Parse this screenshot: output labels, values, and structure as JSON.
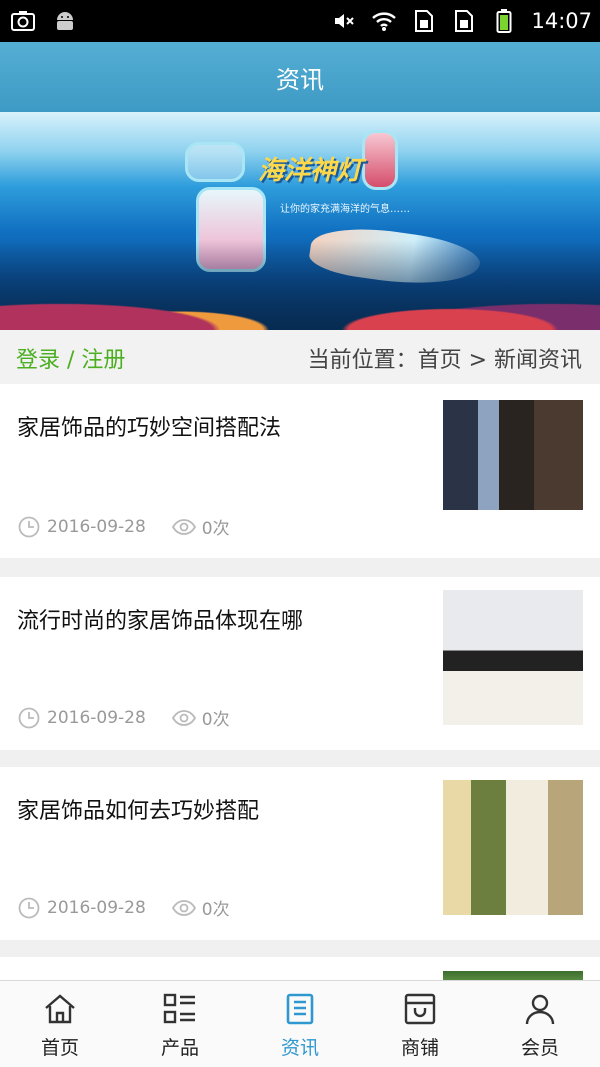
{
  "status_bar": {
    "time": "14:07",
    "left_icons": [
      "screenshot-icon",
      "android-icon"
    ],
    "right_icons": [
      "mute-icon",
      "wifi-icon",
      "sim1-icon",
      "sim2-icon",
      "battery-icon"
    ]
  },
  "header": {
    "title": "资讯"
  },
  "banner": {
    "title": "海洋神灯",
    "subtitle": "让你的家充满海洋的气息……"
  },
  "crumb": {
    "login_label": "登录 / 注册",
    "location": "当前位置：首页 > 新闻资讯"
  },
  "news": [
    {
      "title": "家居饰品的巧妙空间搭配法",
      "date": "2016-09-28",
      "views": "0次"
    },
    {
      "title": "流行时尚的家居饰品体现在哪",
      "date": "2016-09-28",
      "views": "0次"
    },
    {
      "title": "家居饰品如何去巧妙搭配",
      "date": "2016-09-28",
      "views": "0次"
    }
  ],
  "tabs": [
    {
      "label": "首页",
      "icon": "home-icon"
    },
    {
      "label": "产品",
      "icon": "product-list-icon"
    },
    {
      "label": "资讯",
      "icon": "news-icon",
      "active": true
    },
    {
      "label": "商铺",
      "icon": "store-icon"
    },
    {
      "label": "会员",
      "icon": "member-icon"
    }
  ],
  "colors": {
    "header": "#3d9ac4",
    "login": "#4caf22",
    "active_tab": "#2e98cf"
  }
}
